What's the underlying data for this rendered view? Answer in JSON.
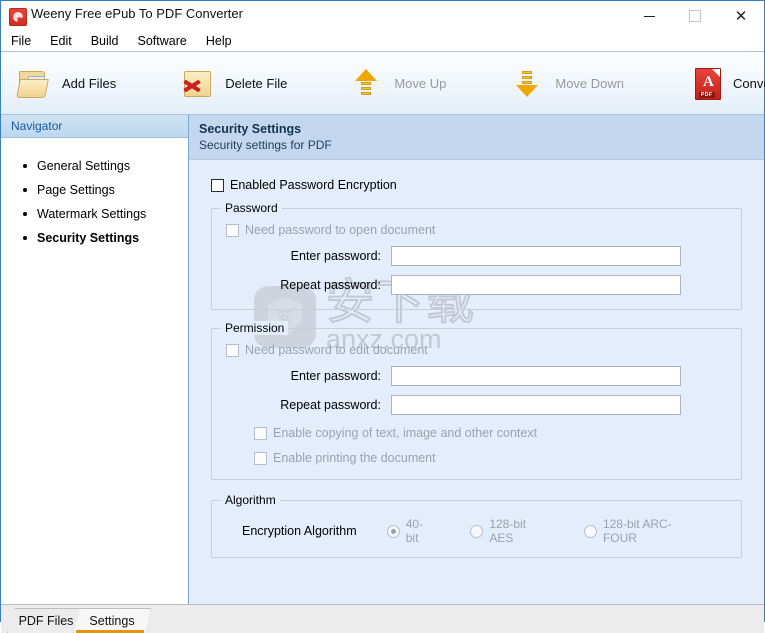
{
  "window": {
    "title": "Weeny Free ePub To PDF Converter",
    "icon": "app-icon",
    "controls": {
      "minimize": "—",
      "maximize": "□",
      "close": "✕"
    }
  },
  "menubar": {
    "items": [
      "File",
      "Edit",
      "Build",
      "Software",
      "Help"
    ]
  },
  "toolbar": {
    "items": [
      {
        "label": "Add Files",
        "icon": "folder-add-icon",
        "disabled": false
      },
      {
        "label": "Delete File",
        "icon": "folder-delete-icon",
        "disabled": false
      },
      {
        "label": "Move Up",
        "icon": "arrow-up-icon",
        "disabled": true
      },
      {
        "label": "Move Down",
        "icon": "arrow-down-icon",
        "disabled": true
      },
      {
        "label": "Convert Now!",
        "icon": "pdf-icon",
        "disabled": false
      }
    ]
  },
  "navigator": {
    "header": "Navigator",
    "items": [
      {
        "label": "General Settings",
        "active": false
      },
      {
        "label": "Page Settings",
        "active": false
      },
      {
        "label": "Watermark Settings",
        "active": false
      },
      {
        "label": "Security Settings",
        "active": true
      }
    ]
  },
  "content": {
    "title": "Security Settings",
    "subtitle": "Security settings for PDF",
    "enable_encryption": {
      "label": "Enabled Password Encryption",
      "checked": false,
      "disabled": false
    },
    "password_group": {
      "legend": "Password",
      "need_password": {
        "label": "Need password to open document",
        "checked": false,
        "disabled": true
      },
      "enter_label": "Enter password:",
      "enter_value": "",
      "repeat_label": "Repeat password:",
      "repeat_value": ""
    },
    "permission_group": {
      "legend": "Permission",
      "need_password": {
        "label": "Need password to edit document",
        "checked": false,
        "disabled": true
      },
      "enter_label": "Enter password:",
      "enter_value": "",
      "repeat_label": "Repeat password:",
      "repeat_value": "",
      "enable_copy": {
        "label": "Enable copying of text, image and other context",
        "checked": false,
        "disabled": true
      },
      "enable_print": {
        "label": "Enable printing the document",
        "checked": false,
        "disabled": true
      }
    },
    "algorithm_group": {
      "legend": "Algorithm",
      "label": "Encryption Algorithm",
      "options": [
        {
          "label": "40-bit",
          "selected": true
        },
        {
          "label": "128-bit AES",
          "selected": false
        },
        {
          "label": "128-bit ARC-FOUR",
          "selected": false
        }
      ]
    }
  },
  "watermark": {
    "badge_glyph": "安",
    "cn_text": "安下载",
    "en_text": "anxz.com"
  },
  "tabs": [
    {
      "label": "PDF Files",
      "active": false
    },
    {
      "label": "Settings",
      "active": true
    }
  ],
  "colors": {
    "window_border": "#2d7dc5",
    "content_bg": "#e4edfb",
    "header_bg": "#c3d8ef",
    "nav_header_bg": "#cfe2f3",
    "tab_accent": "#e8930c"
  }
}
